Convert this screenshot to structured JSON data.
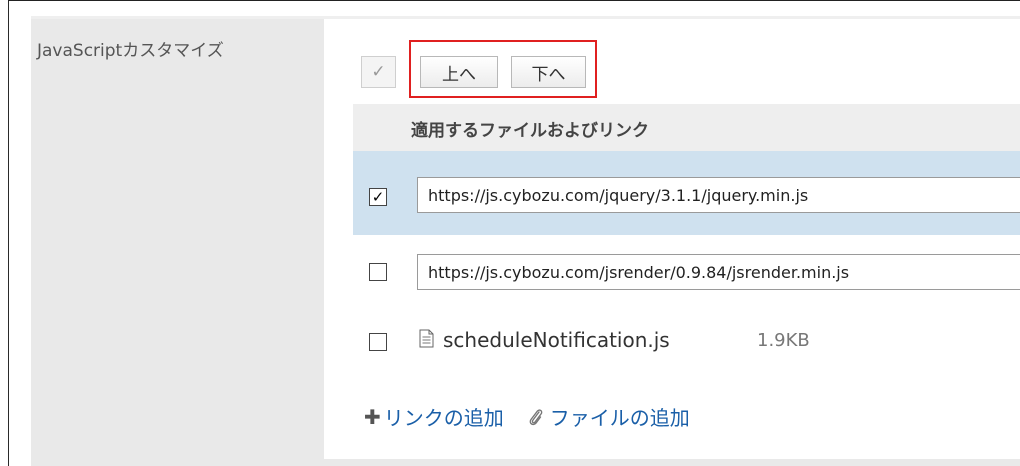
{
  "section_label": "JavaScriptカスタマイズ",
  "toolbar": {
    "select_all_symbol": "✓",
    "up_label": "上へ",
    "down_label": "下へ"
  },
  "table": {
    "header": "適用するファイルおよびリンク",
    "rows": [
      {
        "type": "link",
        "checked": true,
        "check_symbol": "✓",
        "value": "https://js.cybozu.com/jquery/3.1.1/jquery.min.js"
      },
      {
        "type": "link",
        "checked": false,
        "value": "https://js.cybozu.com/jsrender/0.9.84/jsrender.min.js"
      },
      {
        "type": "file",
        "checked": false,
        "name": "scheduleNotification.js",
        "size": "1.9KB"
      }
    ]
  },
  "actions": {
    "add_link_label": "リンクの追加",
    "add_file_label": "ファイルの追加"
  },
  "colors": {
    "highlight_border": "#e02020",
    "selected_row_bg": "#cfe1ef",
    "link_color": "#1a5fa8"
  }
}
